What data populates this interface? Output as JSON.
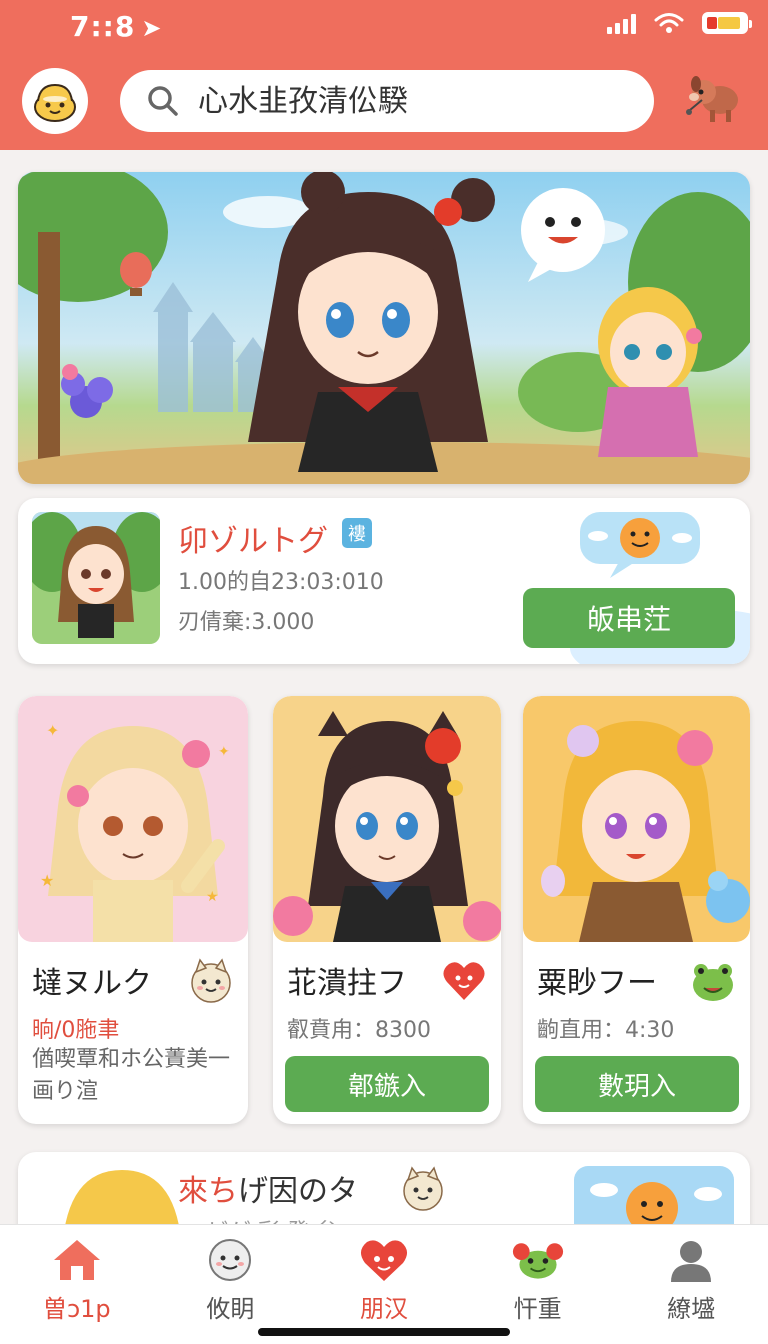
{
  "status_bar": {
    "time": "7::8",
    "location_arrow": "➤"
  },
  "header": {
    "logo_icon": "yellow-mascot-icon",
    "search": {
      "placeholder": "心水韭孜清伀騤",
      "icon": "search-icon"
    },
    "mascot_icon": "brown-dog-mascot-icon"
  },
  "featured": {
    "title": "卯ゾルトグ",
    "badge": "褸",
    "meta_1": "1.00的自23:03:010",
    "meta_2": "刃倩棄:3.000",
    "action_label": "皈串茳"
  },
  "cards": [
    {
      "name": "墶ヌルク",
      "sub": "晌/0胣聿",
      "desc": "偤喫覃和ホ公蔶美一画り渲",
      "emblem": "cream-cat-icon",
      "sub_color": "#e04e3e"
    },
    {
      "name": "苝潰拄フ",
      "sub": "叡賁甪：8300",
      "button": "郼鏃入",
      "emblem": "heart-icon"
    },
    {
      "name": "粟眇フー",
      "sub": "齣直用：4:30",
      "button": "數玥入",
      "emblem": "green-frog-icon"
    }
  ],
  "peek_card": {
    "title_red": "來ち",
    "title_rest": "げ因のタ",
    "sub": "ッ ビゲ 彩 発 矣",
    "emblem": "cream-cat-icon"
  },
  "tabs": [
    {
      "label": "曽ɔ1p",
      "icon": "home-icon",
      "active": true
    },
    {
      "label": "攸眀",
      "icon": "smiley-icon",
      "active": false
    },
    {
      "label": "朋汉",
      "icon": "heart-face-icon",
      "active": false
    },
    {
      "label": "忓重",
      "icon": "frog-icon",
      "active": false
    },
    {
      "label": "繚墭",
      "icon": "profile-icon",
      "active": false
    }
  ],
  "colors": {
    "brand": "#ef6e5d",
    "accent_red": "#e04e3e",
    "button_green": "#5cab52"
  }
}
